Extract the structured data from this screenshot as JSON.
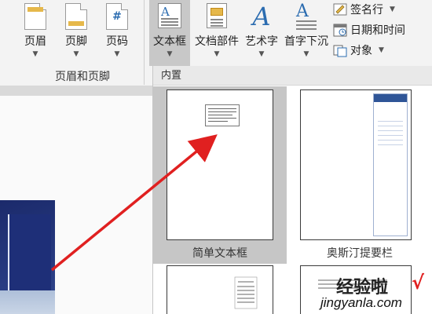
{
  "ribbon": {
    "header_btn": "页眉",
    "footer_btn": "页脚",
    "pagenum_btn": "页码",
    "group_label": "页眉和页脚",
    "pagenum_glyph": "#",
    "textbox_btn": "文本框",
    "parts_btn": "文档部件",
    "wordart_btn": "艺术字",
    "dropcap_btn": "首字下沉",
    "wordart_glyph": "A",
    "signature_btn": "签名行",
    "datetime_btn": "日期和时间",
    "object_btn": "对象"
  },
  "gallery": {
    "section": "内置",
    "items": [
      {
        "label": "简单文本框",
        "selected": true
      },
      {
        "label": "奥斯汀提要栏",
        "selected": false
      }
    ]
  },
  "watermark": {
    "text": "经验啦",
    "check": "√",
    "url": "jingyanla.com"
  },
  "colors": {
    "accent": "#2b6cb0",
    "highlight": "#c6c6c6",
    "arrow": "#e02020"
  }
}
